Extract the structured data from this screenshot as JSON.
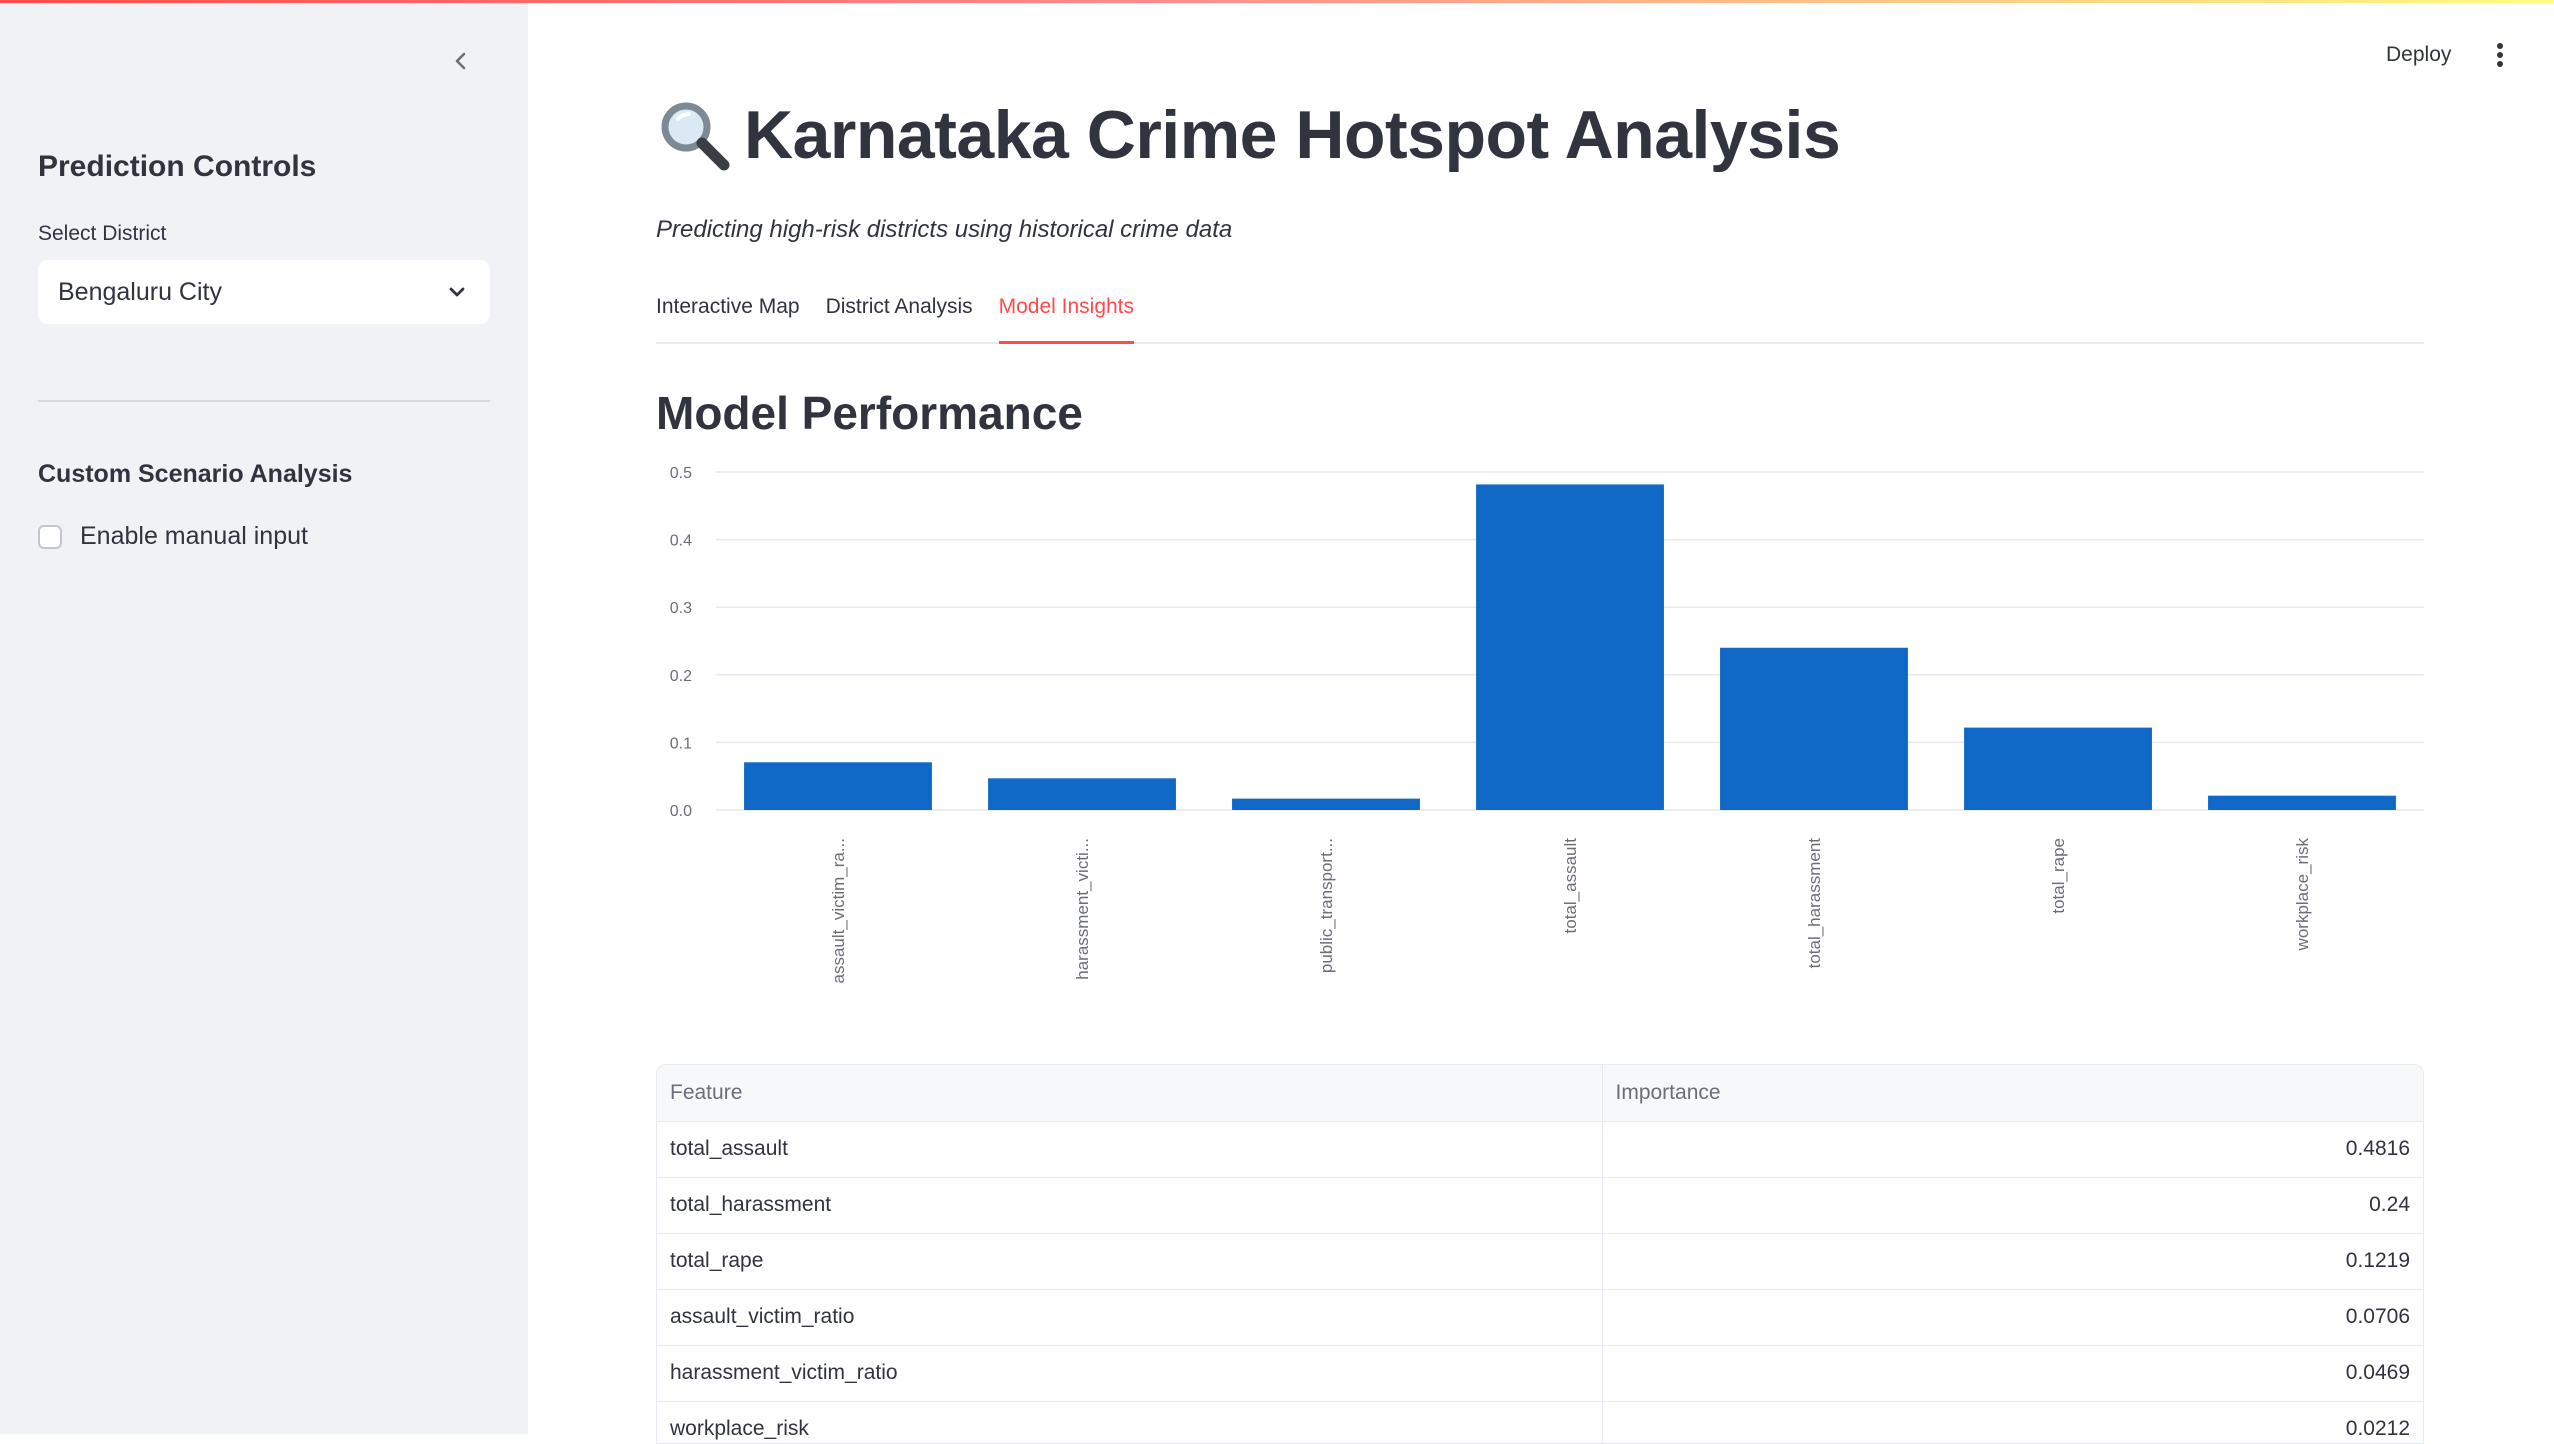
{
  "sidebar": {
    "heading": "Prediction Controls",
    "select_label": "Select District",
    "select_value": "Bengaluru City",
    "subheading": "Custom Scenario Analysis",
    "checkbox_label": "Enable manual input",
    "checkbox_checked": false
  },
  "header": {
    "deploy_label": "Deploy"
  },
  "main": {
    "title_icon": "magnifier-icon",
    "title": "Karnataka Crime Hotspot Analysis",
    "subtitle": "Predicting high-risk districts using historical crime data",
    "tabs": [
      {
        "label": "Interactive Map",
        "active": false
      },
      {
        "label": "District Analysis",
        "active": false
      },
      {
        "label": "Model Insights",
        "active": true
      }
    ],
    "section_heading": "Model Performance"
  },
  "chart_data": {
    "type": "bar",
    "categories": [
      "assault_victim_ra...",
      "harassment_victi...",
      "public_transport...",
      "total_assault",
      "total_harassment",
      "total_rape",
      "workplace_risk"
    ],
    "values": [
      0.0706,
      0.0469,
      0.0168,
      0.4816,
      0.24,
      0.1219,
      0.0212
    ],
    "yticks": [
      "0.0",
      "0.1",
      "0.2",
      "0.3",
      "0.4",
      "0.5"
    ],
    "ylim": [
      0,
      0.5
    ],
    "color": "#1069c6",
    "grid": true,
    "xlabel": "",
    "ylabel": ""
  },
  "table": {
    "headers": [
      "Feature",
      "Importance"
    ],
    "rows": [
      [
        "total_assault",
        "0.4816"
      ],
      [
        "total_harassment",
        "0.24"
      ],
      [
        "total_rape",
        "0.1219"
      ],
      [
        "assault_victim_ratio",
        "0.0706"
      ],
      [
        "harassment_victim_ratio",
        "0.0469"
      ],
      [
        "workplace_risk",
        "0.0212"
      ]
    ]
  },
  "colors": {
    "accent": "#ff4b4b",
    "bar": "#1069c6",
    "sidebar_bg": "#f0f2f6",
    "text": "#31333f"
  }
}
